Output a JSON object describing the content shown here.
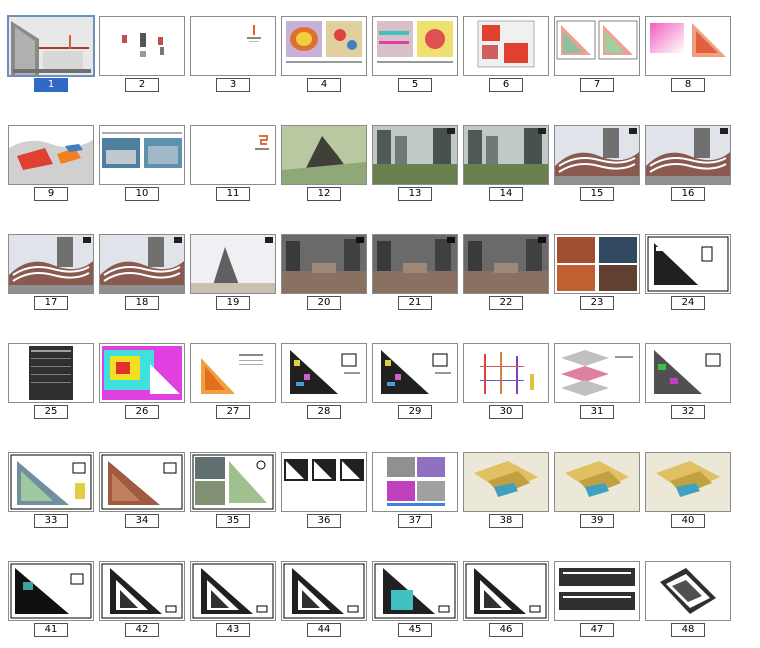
{
  "viewer": {
    "selected_index": 0,
    "colors": {
      "selection": "#316ac5",
      "thumb_border": "#8c8c8c",
      "label_border": "#505050"
    }
  },
  "slides": [
    {
      "number": "1",
      "kind": "cover"
    },
    {
      "number": "2",
      "kind": "diagram-small"
    },
    {
      "number": "3",
      "kind": "title-blank"
    },
    {
      "number": "4",
      "kind": "color-maps"
    },
    {
      "number": "5",
      "kind": "color-maps-2"
    },
    {
      "number": "6",
      "kind": "red-plan"
    },
    {
      "number": "7",
      "kind": "salmon-triangles"
    },
    {
      "number": "8",
      "kind": "pink-gradient"
    },
    {
      "number": "9",
      "kind": "red-blue-render"
    },
    {
      "number": "10",
      "kind": "photo-pair"
    },
    {
      "number": "11",
      "kind": "title-blank-2"
    },
    {
      "number": "12",
      "kind": "render-green"
    },
    {
      "number": "13",
      "kind": "render-buildings"
    },
    {
      "number": "14",
      "kind": "render-buildings"
    },
    {
      "number": "15",
      "kind": "render-curves"
    },
    {
      "number": "16",
      "kind": "render-curves"
    },
    {
      "number": "17",
      "kind": "render-curves"
    },
    {
      "number": "18",
      "kind": "render-curves"
    },
    {
      "number": "19",
      "kind": "render-sky"
    },
    {
      "number": "20",
      "kind": "render-dark"
    },
    {
      "number": "21",
      "kind": "render-dark"
    },
    {
      "number": "22",
      "kind": "render-dark"
    },
    {
      "number": "23",
      "kind": "photo-grid"
    },
    {
      "number": "24",
      "kind": "cad-plan"
    },
    {
      "number": "25",
      "kind": "dark-table"
    },
    {
      "number": "26",
      "kind": "heat-map"
    },
    {
      "number": "27",
      "kind": "orange-triangle"
    },
    {
      "number": "28",
      "kind": "color-plan"
    },
    {
      "number": "29",
      "kind": "color-plan"
    },
    {
      "number": "30",
      "kind": "section-diagram"
    },
    {
      "number": "31",
      "kind": "iso-diagram"
    },
    {
      "number": "32",
      "kind": "color-plan-2"
    },
    {
      "number": "33",
      "kind": "green-plan"
    },
    {
      "number": "34",
      "kind": "brown-plan"
    },
    {
      "number": "35",
      "kind": "photo-plan"
    },
    {
      "number": "36",
      "kind": "three-plans"
    },
    {
      "number": "37",
      "kind": "purple-plans"
    },
    {
      "number": "38",
      "kind": "yellow-iso"
    },
    {
      "number": "39",
      "kind": "yellow-iso"
    },
    {
      "number": "40",
      "kind": "yellow-iso"
    },
    {
      "number": "41",
      "kind": "black-plan"
    },
    {
      "number": "42",
      "kind": "black-plan-2"
    },
    {
      "number": "43",
      "kind": "black-plan-2"
    },
    {
      "number": "44",
      "kind": "black-plan-2"
    },
    {
      "number": "45",
      "kind": "cyan-plan"
    },
    {
      "number": "46",
      "kind": "black-plan-2"
    },
    {
      "number": "47",
      "kind": "elevations"
    },
    {
      "number": "48",
      "kind": "rotated-plan"
    }
  ]
}
